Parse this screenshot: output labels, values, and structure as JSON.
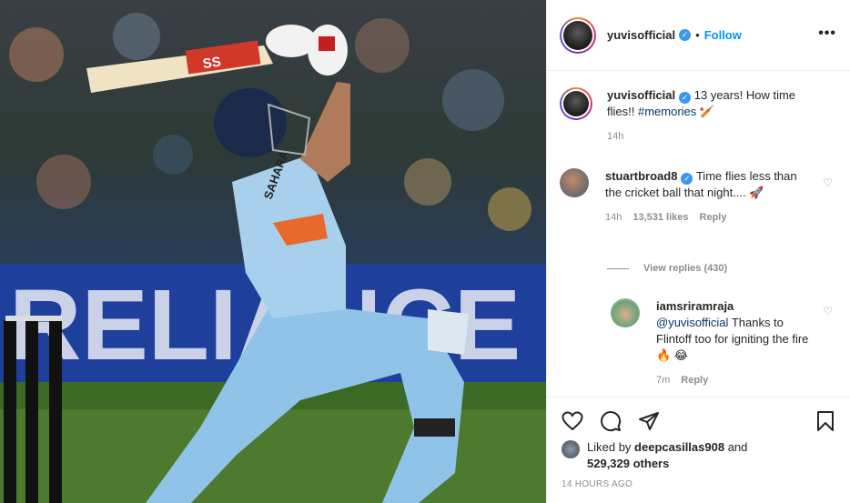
{
  "post": {
    "photo": {
      "board_text": "RELIANCE",
      "stump_text": "RELIANCE",
      "bat_text": "SS",
      "jersey_text": "SAHARA"
    },
    "header": {
      "username": "yuvisofficial",
      "separator": "•",
      "follow_label": "Follow",
      "more_label": "•••"
    },
    "caption": {
      "username": "yuvisofficial",
      "text": " 13 years! How time flies!! ",
      "hashtag": "#memories",
      "emoji": "🏏",
      "time": "14h"
    },
    "comments": [
      {
        "username": "stuartbroad8",
        "verified": true,
        "text": " Time flies less than the cricket ball that night.... 🚀",
        "time": "14h",
        "likes": "13,531 likes",
        "reply_label": "Reply"
      }
    ],
    "view_replies": "View replies (430)",
    "reply": {
      "username": "iamsriramraja",
      "mention": "@yuvisofficial",
      "text": " Thanks to Flintoff too for igniting the fire 🔥 😂",
      "time": "7m",
      "reply_label": "Reply"
    },
    "footer": {
      "liked_prefix": "Liked by ",
      "liked_user": "deepcasillas908",
      "liked_and": " and ",
      "liked_others": "529,329 others",
      "ago": "14 HOURS AGO"
    },
    "colors": {
      "accent": "#0095f6",
      "verified": "#3897f0",
      "muted": "#8e8e8e",
      "jersey": "#8fc3e8"
    }
  }
}
